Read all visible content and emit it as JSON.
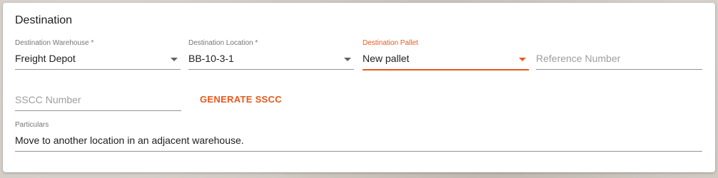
{
  "section": {
    "title": "Destination"
  },
  "fields": {
    "destination_warehouse": {
      "label": "Destination Warehouse *",
      "value": "Freight Depot"
    },
    "destination_location": {
      "label": "Destination Location *",
      "value": "BB-10-3-1"
    },
    "destination_pallet": {
      "label": "Destination Pallet",
      "value": "New pallet"
    },
    "reference_number": {
      "placeholder": "Reference Number"
    },
    "sscc_number": {
      "placeholder": "SSCC Number"
    },
    "particulars": {
      "label": "Particulars",
      "value": "Move to another location in an adjacent warehouse."
    }
  },
  "actions": {
    "generate_sscc_label": "GENERATE SSCC"
  },
  "colors": {
    "accent": "#e8581c",
    "text": "#212121",
    "label": "#757575",
    "placeholder": "#9e9e9e",
    "underline": "#949494"
  },
  "icons": {
    "dropdown": "chevron-down-icon"
  }
}
